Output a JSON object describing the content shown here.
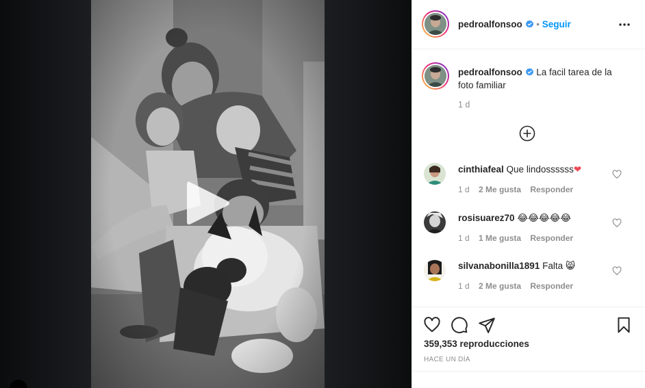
{
  "post": {
    "username": "pedroalfonsoo",
    "separator": "•",
    "follow_label": "Seguir",
    "caption": "La facil tarea de la foto familiar",
    "caption_time": "1 d",
    "views": "359,353 reproducciones",
    "posted_ago": "HACE UN DÍA"
  },
  "comments": [
    {
      "username": "cinthiafeal",
      "text": "Que lindossssss",
      "emoji": "❤",
      "time": "1 d",
      "likes": "2 Me gusta",
      "reply": "Responder"
    },
    {
      "username": "rosisuarez70",
      "text": "",
      "emoji": "😂😂😂😂😂",
      "time": "1 d",
      "likes": "1 Me gusta",
      "reply": "Responder"
    },
    {
      "username": "silvanabonilla1891",
      "text": "Falta",
      "emoji": "😸",
      "time": "1 d",
      "likes": "2 Me gusta",
      "reply": "Responder"
    }
  ],
  "icons": {
    "more": "more-options-icon",
    "verified": "verified-badge-icon",
    "load_more": "plus-circle-icon",
    "like": "heart-icon",
    "comment": "comment-icon",
    "share": "send-icon",
    "save": "bookmark-icon",
    "play": "play-icon"
  },
  "colors": {
    "accent": "#0095f6",
    "text": "#262626",
    "muted": "#8e8e8e",
    "media_background": "#111315",
    "heart_red": "#ed4956"
  }
}
